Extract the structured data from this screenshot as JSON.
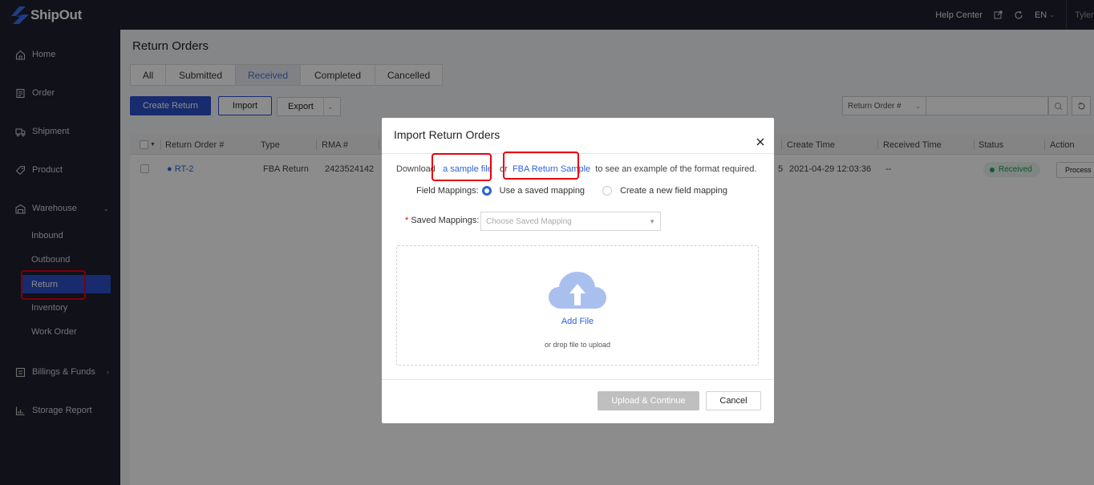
{
  "app": {
    "name": "ShipOut"
  },
  "topbar": {
    "help_center": "Help Center",
    "language": "EN",
    "user": "Tyler"
  },
  "sidebar": {
    "items": [
      {
        "label": "Home",
        "icon": "home-icon"
      },
      {
        "label": "Order",
        "icon": "order-icon"
      },
      {
        "label": "Shipment",
        "icon": "shipment-icon"
      },
      {
        "label": "Product",
        "icon": "tag-icon"
      },
      {
        "label": "Warehouse",
        "icon": "warehouse-icon"
      },
      {
        "label": "Billings & Funds",
        "icon": "billing-icon"
      },
      {
        "label": "Storage Report",
        "icon": "chart-icon"
      }
    ],
    "warehouse_sub": [
      "Inbound",
      "Outbound",
      "Return",
      "Inventory",
      "Work Order"
    ],
    "active_sub": "Return"
  },
  "page": {
    "title": "Return Orders",
    "tabs": [
      "All",
      "Submitted",
      "Received",
      "Completed",
      "Cancelled"
    ],
    "active_tab": "Received",
    "create_label": "Create Return",
    "import_label": "Import",
    "export_label": "Export",
    "search_field": "Return Order #"
  },
  "table": {
    "columns": [
      "Return Order #",
      "Type",
      "RMA #",
      "Create Time",
      "Received Time",
      "Status",
      "Action"
    ],
    "row": {
      "order": "RT-2",
      "type": "FBA Return",
      "rma": "2423524142",
      "partial": "5",
      "create_time": "2021-04-29 12:03:36",
      "received_time": "--",
      "status": "Received",
      "action": "Process"
    }
  },
  "modal": {
    "title": "Import Return Orders",
    "download_prefix": "Download",
    "sample_link": "a sample file",
    "or_text": "or",
    "fba_link": "FBA Return Sample",
    "download_suffix": "to see an example of the format required.",
    "field_mappings_label": "Field Mappings:",
    "option_saved": "Use a saved mapping",
    "option_new": "Create a new field mapping",
    "saved_mappings_label": "Saved Mappings:",
    "saved_mappings_placeholder": "Choose Saved Mapping",
    "add_file": "Add File",
    "drop_hint": "or drop file to upload",
    "upload_button": "Upload & Continue",
    "cancel_button": "Cancel"
  },
  "colors": {
    "primary": "#2d4fc9",
    "sidebar_bg": "#1e1f2e",
    "highlight": "#e60012",
    "status_green": "#1f9d55"
  }
}
